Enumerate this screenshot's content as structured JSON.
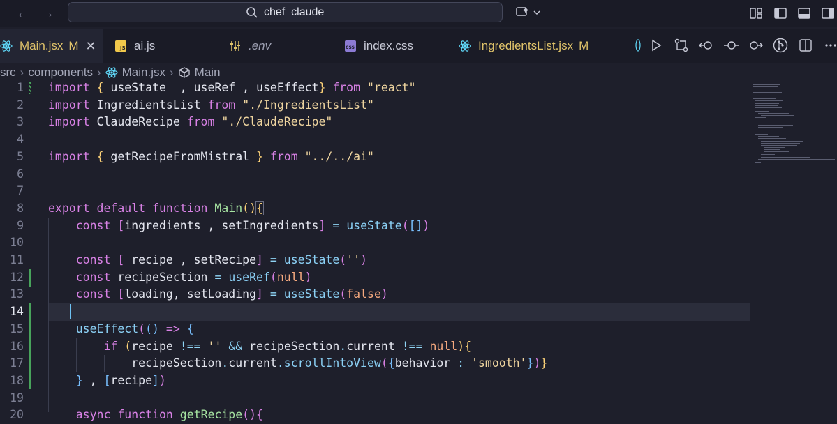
{
  "window": {
    "search_text": "chef_claude"
  },
  "tabs": [
    {
      "label": "Main.jsx",
      "modified": "M",
      "active": true,
      "icon": "react-icon"
    },
    {
      "label": "ai.js",
      "icon": "js-file-icon"
    },
    {
      "label": ".env",
      "icon": "env-settings-icon"
    },
    {
      "label": "index.css",
      "icon": "css-file-icon"
    },
    {
      "label": "IngredientsList.jsx",
      "modified": "M",
      "icon": "react-icon"
    }
  ],
  "breadcrumb": {
    "items": [
      "src",
      "components",
      "Main.jsx",
      "Main"
    ]
  },
  "editor": {
    "current_line": "14",
    "line_numbers": [
      "1",
      "2",
      "3",
      "4",
      "5",
      "6",
      "7",
      "8",
      "9",
      "10",
      "11",
      "12",
      "13",
      "14",
      "15",
      "16",
      "17",
      "18",
      "19",
      "20"
    ]
  },
  "colors": {
    "background": "#1e1f2b",
    "accent_modified": "#e0c36a",
    "keyword": "#d881e5",
    "string": "#eed49f",
    "function": "#8bd0f5",
    "git_added": "#48a35b"
  }
}
